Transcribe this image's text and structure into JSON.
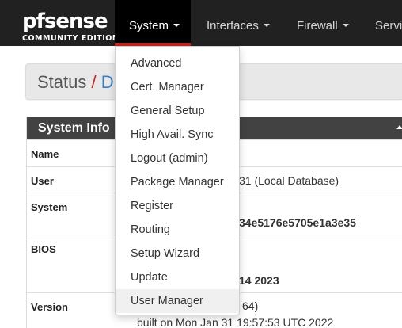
{
  "brand": {
    "logo_text": "pfsense",
    "edition": "COMMUNITY EDITION"
  },
  "nav": {
    "system": "System",
    "interfaces": "Interfaces",
    "firewall": "Firewall",
    "services": "Servic"
  },
  "breadcrumb": {
    "status": "Status",
    "separator": "/",
    "current": "D"
  },
  "panel": {
    "title": "System Info",
    "rows": {
      "name": {
        "label": "Name"
      },
      "user": {
        "label": "User",
        "value": "31 (Local Database)"
      },
      "system": {
        "label": "System",
        "value": "34e5176e5705e1a3e35"
      },
      "bios": {
        "label": "BIOS",
        "value": "14 2023"
      },
      "version": {
        "label": "Version",
        "value": "64)",
        "built": "built on Mon Jan 31 19:57:53 UTC 2022"
      }
    }
  },
  "system_menu": {
    "items": [
      "Advanced",
      "Cert. Manager",
      "General Setup",
      "High Avail. Sync",
      "Logout (admin)",
      "Package Manager",
      "Register",
      "Routing",
      "Setup Wizard",
      "Update",
      "User Manager"
    ]
  },
  "colors": {
    "navbar": "#212121",
    "active_tab": "#000000",
    "accent_red": "#c3251e",
    "link_blue": "#3b7bbf",
    "panel_heading": "#424242"
  }
}
